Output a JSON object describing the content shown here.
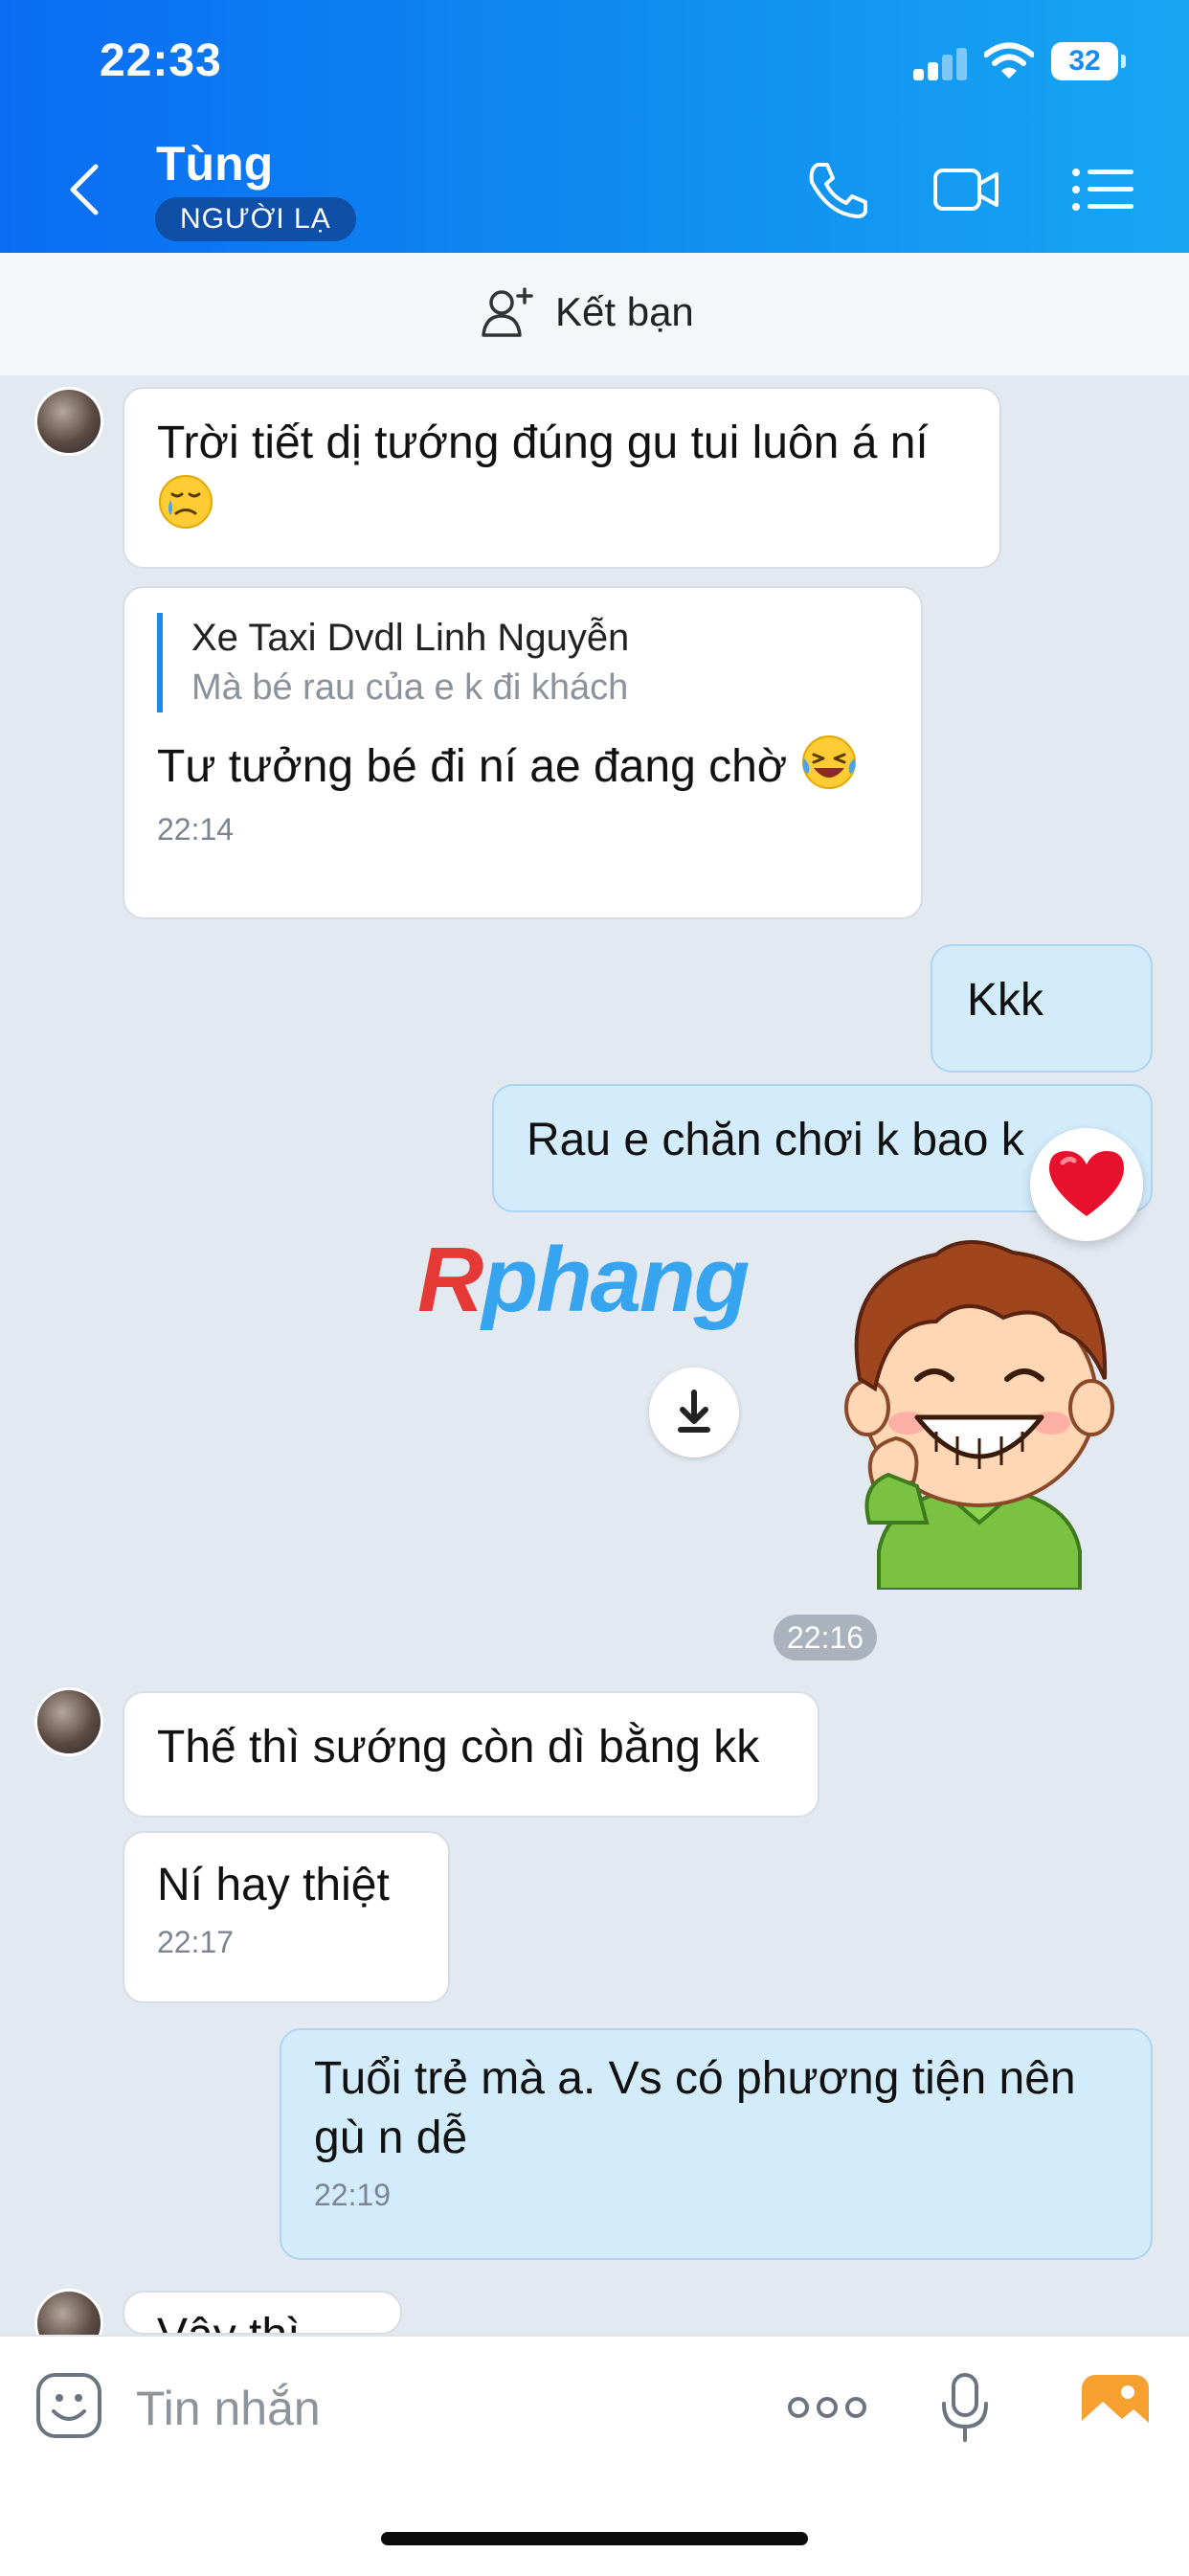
{
  "status": {
    "time": "22:33",
    "battery": "32"
  },
  "header": {
    "name": "Tùng",
    "badge": "NGƯỜI LẠ",
    "icons": [
      "back-icon",
      "phone-icon",
      "video-call-icon",
      "menu-list-icon"
    ]
  },
  "add_friend": {
    "label": "Kết bạn"
  },
  "messages": {
    "m1": {
      "text": "Trời tiết dị tướng đúng gu tui luôn á ní",
      "emoji": "crying-face"
    },
    "m2": {
      "quote_name": "Xe Taxi Dvdl Linh Nguyễn",
      "quote_text": "Mà bé rau của e k đi khách",
      "text": "Tư tưởng bé đi ní ae đang chờ",
      "emoji": "laughing-tears",
      "time": "22:14"
    },
    "m3": {
      "text": "Kkk"
    },
    "m4": {
      "text": "Rau e chăn chơi k bao k",
      "reaction": "heart"
    },
    "time_pill": "22:16",
    "m5": {
      "text": "Thế thì sướng còn dì bằng kk"
    },
    "m6": {
      "text": "Ní hay thiệt",
      "time": "22:17"
    },
    "m7": {
      "line1": "Tuổi trẻ mà a. Vs có phương tiện nên",
      "line2": "gù n dễ",
      "time": "22:19"
    },
    "m8": {
      "text": "Vậy thì…"
    }
  },
  "watermark": {
    "r": "R",
    "rest": "phang"
  },
  "input": {
    "placeholder": "Tin nhắn"
  },
  "colors": {
    "header_start": "#0a6cf2",
    "header_end": "#18a6f2",
    "outgoing": "#d3ecfc",
    "chat_bg": "#e2e9f1"
  }
}
